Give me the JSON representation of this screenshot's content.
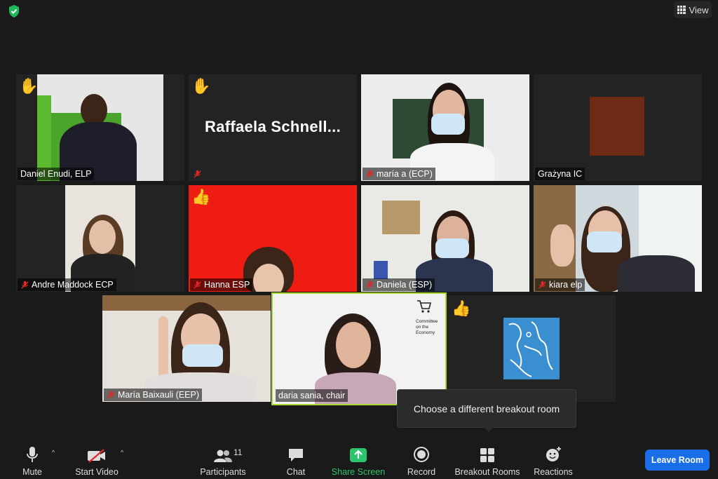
{
  "header": {
    "view_label": "View"
  },
  "participants": [
    {
      "name": "Daniel Enudi, ELP",
      "muted": false,
      "reaction": "✋"
    },
    {
      "name": "Raffaela Schnell...",
      "muted": true,
      "reaction": "✋",
      "display_name_large": "Raffaela Schnell..."
    },
    {
      "name": "maría a (ECP)",
      "muted": true
    },
    {
      "name": "Grażyna IC",
      "muted": false
    },
    {
      "name": "Andre Maddock ECP",
      "muted": true
    },
    {
      "name": "Hanna ESP",
      "muted": true,
      "reaction": "👍"
    },
    {
      "name": "Daniela (ESP)",
      "muted": true
    },
    {
      "name": "kiara elp",
      "muted": true
    },
    {
      "name": "María Baixauli (EEP)",
      "muted": true
    },
    {
      "name": "daria sania, chair",
      "muted": false,
      "active_speaker": true,
      "backdrop_text": "Committee on the Economy"
    },
    {
      "name": "",
      "muted": false,
      "reaction": "👍"
    }
  ],
  "tooltip": {
    "text": "Choose a different breakout room"
  },
  "toolbar": {
    "mute": "Mute",
    "start_video": "Start Video",
    "participants": "Participants",
    "participants_count": "11",
    "chat": "Chat",
    "share_screen": "Share Screen",
    "record": "Record",
    "breakout_rooms": "Breakout Rooms",
    "reactions": "Reactions",
    "leave_room": "Leave Room"
  },
  "colors": {
    "share_green": "#2ec46c",
    "leave_blue": "#1a6ee8",
    "active_border": "#a8d82a",
    "muted_red": "#e02828"
  }
}
